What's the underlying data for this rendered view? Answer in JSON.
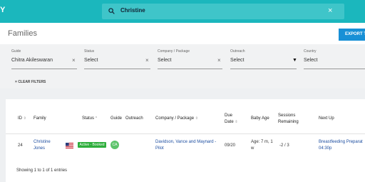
{
  "topbar": {
    "logo": "Y",
    "search_value": "Christine",
    "clear_icon": "close-icon",
    "search_icon": "search-icon"
  },
  "header": {
    "title": "Families",
    "export_label": "EXPORT TO"
  },
  "filters": [
    {
      "label": "Guide",
      "value": "Chitra Akileswaran",
      "control": "clear"
    },
    {
      "label": "Status",
      "value": "Select",
      "control": "clear"
    },
    {
      "label": "Company / Package",
      "value": "Select",
      "control": "clear"
    },
    {
      "label": "Outreach",
      "value": "Select",
      "control": "dropdown"
    },
    {
      "label": "Country",
      "value": "Select",
      "control": "none"
    }
  ],
  "clear_filters_label": "CLEAR FILTERS",
  "table": {
    "columns": {
      "id": "ID",
      "family": "Family",
      "status": "Status",
      "guide": "Guide",
      "outreach": "Outreach",
      "company": "Company / Package",
      "due_date_1": "Due",
      "due_date_2": "Date",
      "baby_age": "Baby Age",
      "sessions_1": "Sessions",
      "sessions_2": "Remaining",
      "next_up": "Next Up"
    },
    "rows": [
      {
        "id": "24",
        "family_line1": "Christine",
        "family_line2": "Jones",
        "status": "Active - Booked",
        "guide_initials": "CA",
        "company_line1": "Davidson, Vance and Maynard -",
        "company_line2": "Pilot",
        "due_date": "09/20",
        "baby_age_line1": "Age: 7 m, 1",
        "baby_age_line2": "w",
        "sessions": "-2 / 3",
        "next_up_line1": "Breastfeeding Preparat",
        "next_up_line2": "04:30p"
      }
    ]
  },
  "footer": "Showing 1 to 1 of 1 entries",
  "colors": {
    "topbar": "#1bb7bd",
    "export": "#1890d6",
    "status_active": "#2eae3c",
    "link": "#1d4ea0"
  }
}
